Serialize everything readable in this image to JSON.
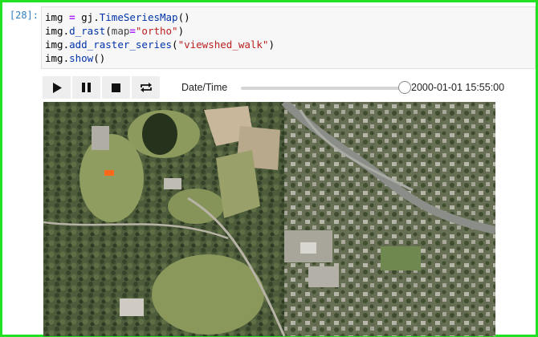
{
  "prompt": "[28]:",
  "code": {
    "line1": {
      "a": "img",
      "op": "=",
      "b": "gj.",
      "c": "TimeSeriesMap",
      "d": "()"
    },
    "line2": {
      "a": "img.",
      "fn": "d_rast",
      "b": "(",
      "kw": "map",
      "op": "=",
      "str": "\"ortho\"",
      "c": ")"
    },
    "line3": {
      "a": "img.",
      "fn": "add_raster_series",
      "b": "(",
      "str": "\"viewshed_walk\"",
      "c": ")"
    },
    "line4": {
      "a": "img.",
      "fn": "show",
      "b": "()"
    }
  },
  "player": {
    "buttons": [
      {
        "name": "play-icon",
        "active": true
      },
      {
        "name": "pause-icon",
        "active": false
      },
      {
        "name": "stop-icon",
        "active": false
      },
      {
        "name": "loop-icon",
        "active": true
      }
    ]
  },
  "slider": {
    "label": "Date/Time",
    "position": 1.0,
    "value_text": "2000-01-01 15:55:00"
  },
  "colors": {
    "accent_border": "#22e022",
    "prompt": "#307fc1",
    "highlight_patch": "#ff6a1a"
  }
}
